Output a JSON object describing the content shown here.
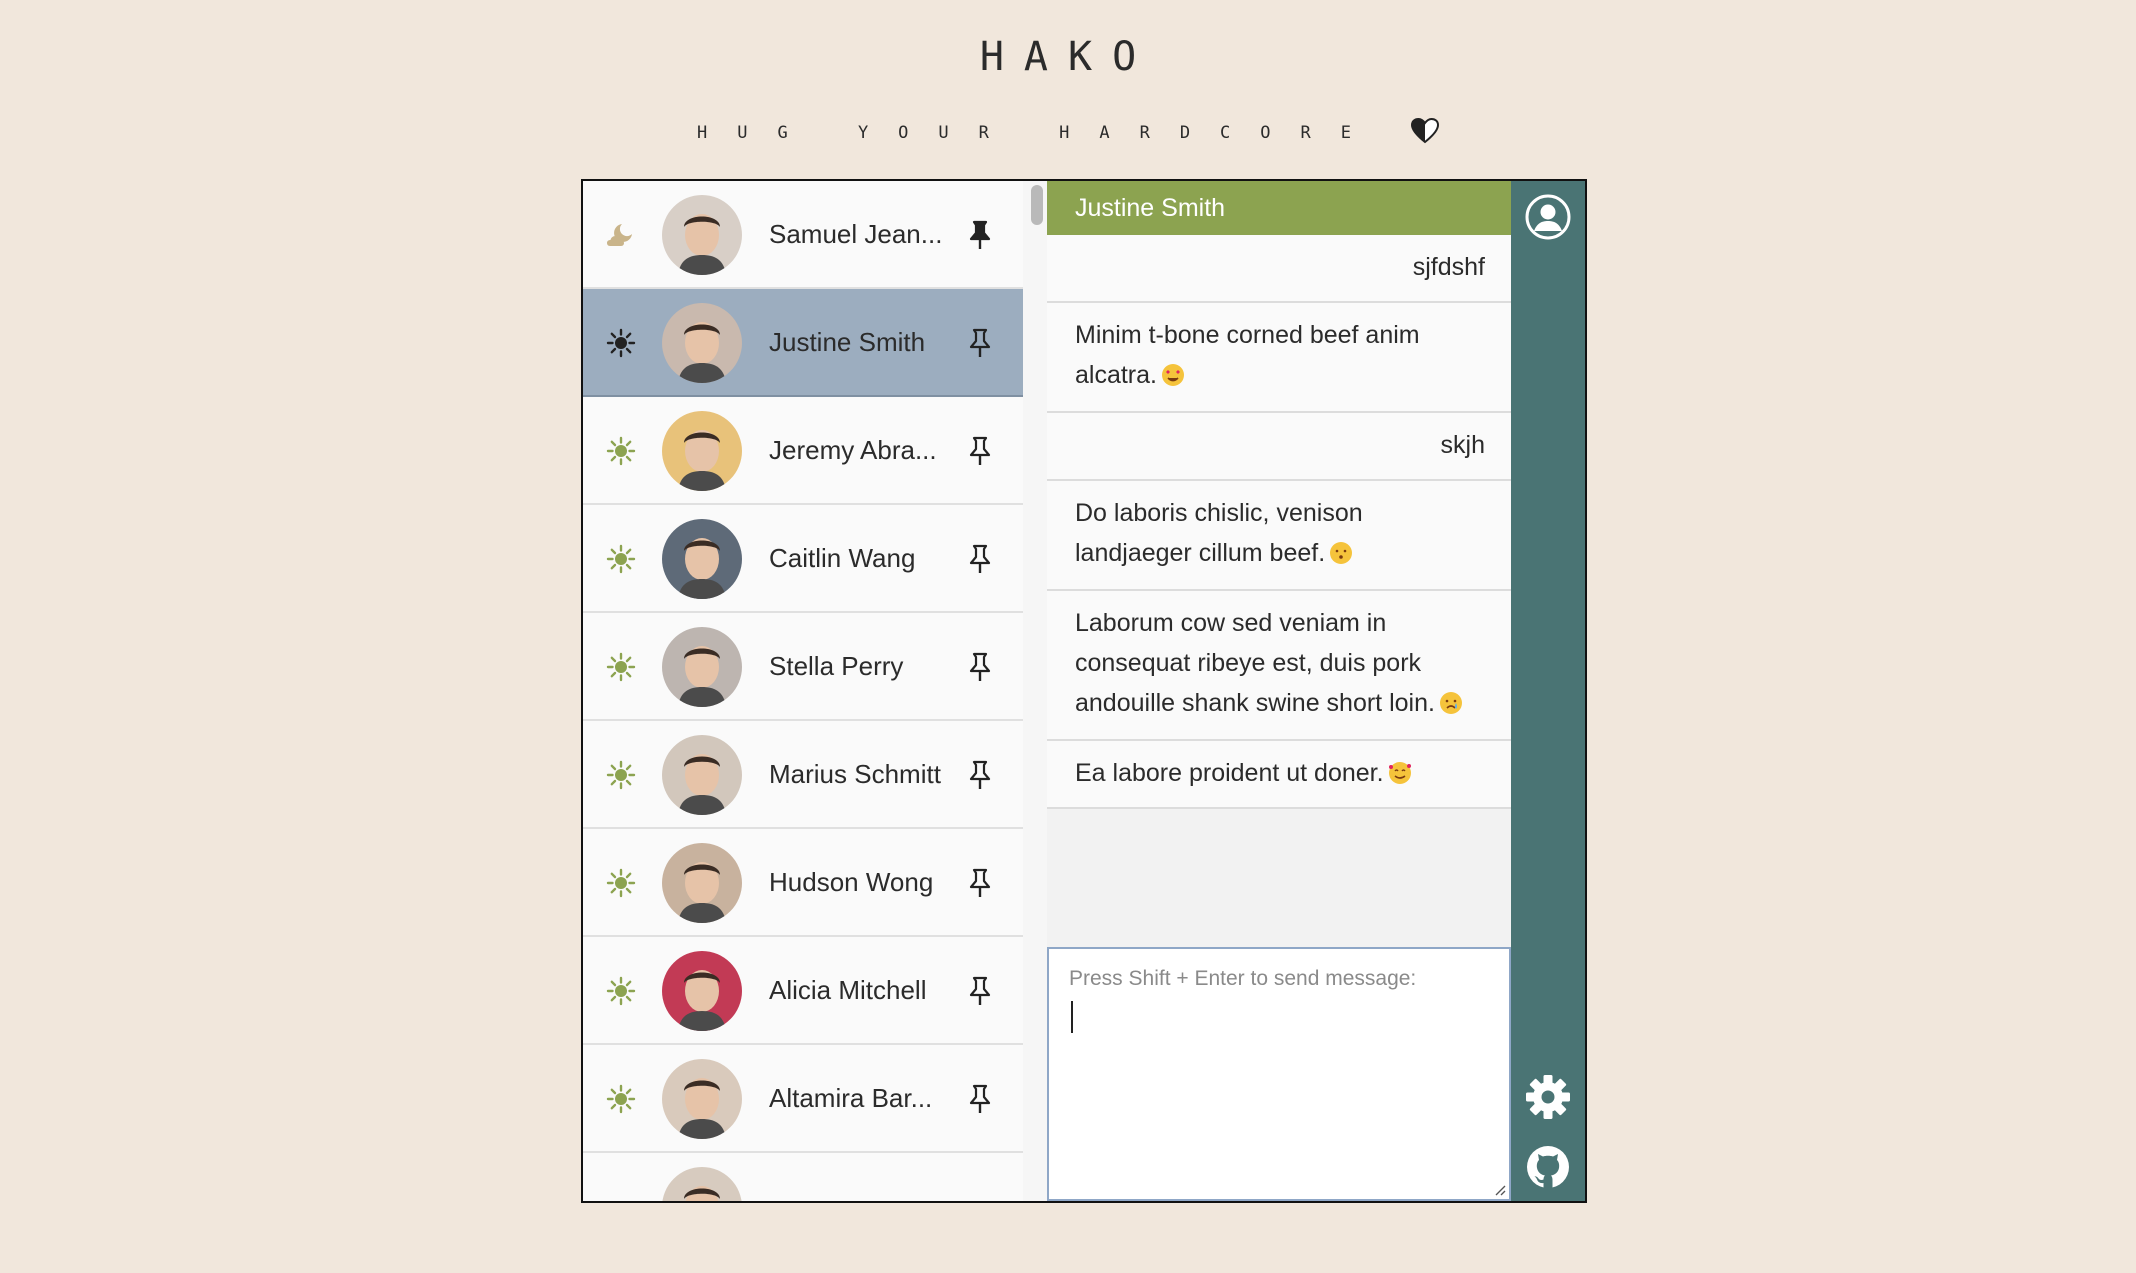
{
  "brand": {
    "title": "HAKO",
    "tagline": "HUG YOUR HARDCORE"
  },
  "contacts": [
    {
      "name": "Samuel Jean...",
      "status_icon": "moon-cloud-icon",
      "pinned": true,
      "active": false,
      "avatar_color": "#d8cfc7"
    },
    {
      "name": "Justine Smith",
      "status_icon": "sun-icon",
      "pinned": false,
      "active": true,
      "avatar_color": "#c9b9ae"
    },
    {
      "name": "Jeremy Abra...",
      "status_icon": "sun-icon",
      "pinned": false,
      "active": false,
      "avatar_color": "#e8c27a"
    },
    {
      "name": "Caitlin Wang",
      "status_icon": "sun-icon",
      "pinned": false,
      "active": false,
      "avatar_color": "#5e6a78"
    },
    {
      "name": "Stella Perry",
      "status_icon": "sun-icon",
      "pinned": false,
      "active": false,
      "avatar_color": "#bdb5b0"
    },
    {
      "name": "Marius Schmitt",
      "status_icon": "sun-icon",
      "pinned": false,
      "active": false,
      "avatar_color": "#d2c7bc"
    },
    {
      "name": "Hudson Wong",
      "status_icon": "sun-icon",
      "pinned": false,
      "active": false,
      "avatar_color": "#c8b29e"
    },
    {
      "name": "Alicia Mitchell",
      "status_icon": "sun-icon",
      "pinned": false,
      "active": false,
      "avatar_color": "#c23a55"
    },
    {
      "name": "Altamira Bar...",
      "status_icon": "sun-icon",
      "pinned": false,
      "active": false,
      "avatar_color": "#d9cabc"
    }
  ],
  "chat": {
    "header": "Justine Smith",
    "messages": [
      {
        "text": "sjfdshf",
        "direction": "out",
        "emoji": ""
      },
      {
        "text": "Minim t-bone corned beef anim alcatra.",
        "direction": "in",
        "emoji": "heart-eyes-emoji"
      },
      {
        "text": "skjh",
        "direction": "out",
        "emoji": ""
      },
      {
        "text": "Do laboris chislic, venison landjaeger cillum beef.",
        "direction": "in",
        "emoji": "kissing-emoji"
      },
      {
        "text": "Laborum cow sed veniam in consequat ribeye est, duis pork andouille shank swine short loin.",
        "direction": "in",
        "emoji": "crying-emoji"
      },
      {
        "text": "Ea labore proident ut doner.",
        "direction": "in",
        "emoji": "smiling-hearts-emoji"
      }
    ],
    "composer": {
      "placeholder": "Press Shift + Enter to send message:",
      "value": ""
    }
  },
  "rail": {
    "top_icon": "user-circle-icon",
    "bottom_icons": [
      "gear-icon",
      "github-icon"
    ]
  },
  "colors": {
    "background": "#f1e7dc",
    "header_green": "#8ca350",
    "rail_teal": "#4a7474",
    "active_contact": "#9cadbf",
    "status_sun": "#8ca350",
    "status_moon": "#c9b48a"
  }
}
